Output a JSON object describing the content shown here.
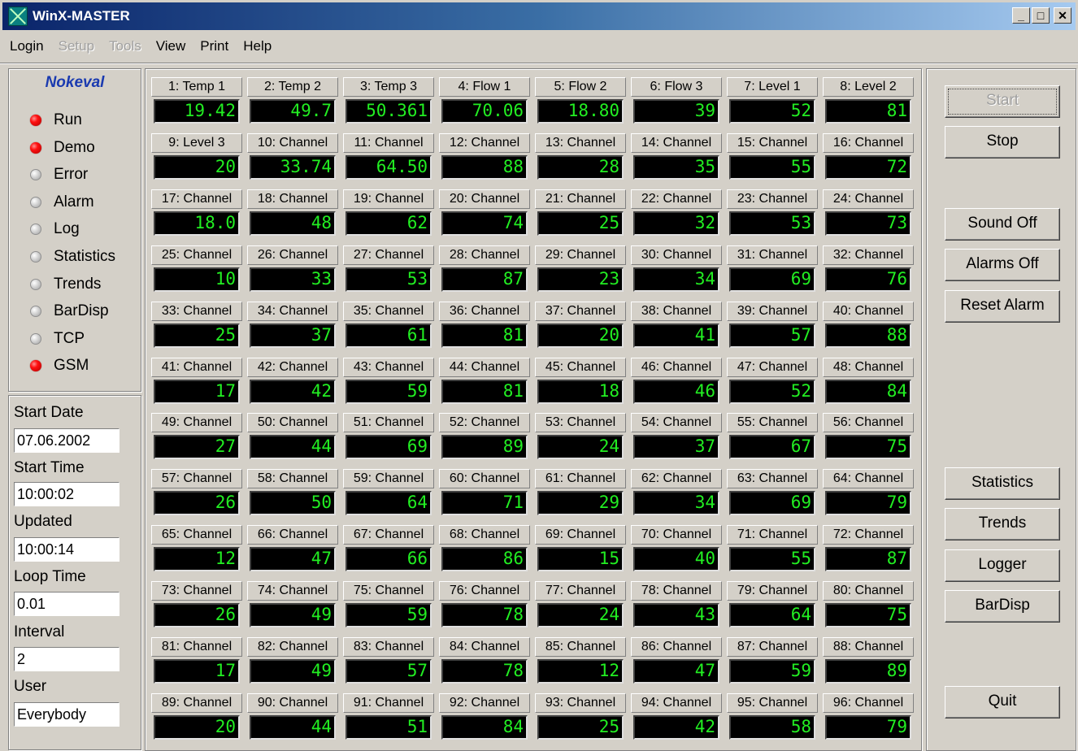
{
  "window": {
    "title": "WinX-MASTER"
  },
  "menu": [
    {
      "label": "Login",
      "enabled": true
    },
    {
      "label": "Setup",
      "enabled": false
    },
    {
      "label": "Tools",
      "enabled": false
    },
    {
      "label": "View",
      "enabled": true
    },
    {
      "label": "Print",
      "enabled": true
    },
    {
      "label": "Help",
      "enabled": true
    }
  ],
  "status": {
    "brand": "Nokeval",
    "indicators": [
      {
        "label": "Run",
        "on": true
      },
      {
        "label": "Demo",
        "on": true
      },
      {
        "label": "Error",
        "on": false
      },
      {
        "label": "Alarm",
        "on": false
      },
      {
        "label": "Log",
        "on": false
      },
      {
        "label": "Statistics",
        "on": false
      },
      {
        "label": "Trends",
        "on": false
      },
      {
        "label": "BarDisp",
        "on": false
      },
      {
        "label": "TCP",
        "on": false
      },
      {
        "label": "GSM",
        "on": true
      }
    ]
  },
  "info": {
    "start_date_label": "Start Date",
    "start_date": "07.06.2002",
    "start_time_label": "Start Time",
    "start_time": "10:00:02",
    "updated_label": "Updated",
    "updated": "10:00:14",
    "loop_time_label": "Loop Time",
    "loop_time": "0.01",
    "interval_label": "Interval",
    "interval": "2",
    "user_label": "User",
    "user": "Everybody"
  },
  "channels": [
    {
      "label": "1: Temp 1",
      "value": "19.42"
    },
    {
      "label": "2: Temp 2",
      "value": "49.7"
    },
    {
      "label": "3: Temp 3",
      "value": "50.361"
    },
    {
      "label": "4: Flow 1",
      "value": "70.06"
    },
    {
      "label": "5: Flow 2",
      "value": "18.80"
    },
    {
      "label": "6: Flow 3",
      "value": "39"
    },
    {
      "label": "7: Level 1",
      "value": "52"
    },
    {
      "label": "8: Level 2",
      "value": "81"
    },
    {
      "label": "9: Level 3",
      "value": "20"
    },
    {
      "label": "10: Channel",
      "value": "33.74"
    },
    {
      "label": "11: Channel",
      "value": "64.50"
    },
    {
      "label": "12: Channel",
      "value": "88"
    },
    {
      "label": "13: Channel",
      "value": "28"
    },
    {
      "label": "14: Channel",
      "value": "35"
    },
    {
      "label": "15: Channel",
      "value": "55"
    },
    {
      "label": "16: Channel",
      "value": "72"
    },
    {
      "label": "17: Channel",
      "value": "18.0"
    },
    {
      "label": "18: Channel",
      "value": "48"
    },
    {
      "label": "19: Channel",
      "value": "62"
    },
    {
      "label": "20: Channel",
      "value": "74"
    },
    {
      "label": "21: Channel",
      "value": "25"
    },
    {
      "label": "22: Channel",
      "value": "32"
    },
    {
      "label": "23: Channel",
      "value": "53"
    },
    {
      "label": "24: Channel",
      "value": "73"
    },
    {
      "label": "25: Channel",
      "value": "10"
    },
    {
      "label": "26: Channel",
      "value": "33"
    },
    {
      "label": "27: Channel",
      "value": "53"
    },
    {
      "label": "28: Channel",
      "value": "87"
    },
    {
      "label": "29: Channel",
      "value": "23"
    },
    {
      "label": "30: Channel",
      "value": "34"
    },
    {
      "label": "31: Channel",
      "value": "69"
    },
    {
      "label": "32: Channel",
      "value": "76"
    },
    {
      "label": "33: Channel",
      "value": "25"
    },
    {
      "label": "34: Channel",
      "value": "37"
    },
    {
      "label": "35: Channel",
      "value": "61"
    },
    {
      "label": "36: Channel",
      "value": "81"
    },
    {
      "label": "37: Channel",
      "value": "20"
    },
    {
      "label": "38: Channel",
      "value": "41"
    },
    {
      "label": "39: Channel",
      "value": "57"
    },
    {
      "label": "40: Channel",
      "value": "88"
    },
    {
      "label": "41: Channel",
      "value": "17"
    },
    {
      "label": "42: Channel",
      "value": "42"
    },
    {
      "label": "43: Channel",
      "value": "59"
    },
    {
      "label": "44: Channel",
      "value": "81"
    },
    {
      "label": "45: Channel",
      "value": "18"
    },
    {
      "label": "46: Channel",
      "value": "46"
    },
    {
      "label": "47: Channel",
      "value": "52"
    },
    {
      "label": "48: Channel",
      "value": "84"
    },
    {
      "label": "49: Channel",
      "value": "27"
    },
    {
      "label": "50: Channel",
      "value": "44"
    },
    {
      "label": "51: Channel",
      "value": "69"
    },
    {
      "label": "52: Channel",
      "value": "89"
    },
    {
      "label": "53: Channel",
      "value": "24"
    },
    {
      "label": "54: Channel",
      "value": "37"
    },
    {
      "label": "55: Channel",
      "value": "67"
    },
    {
      "label": "56: Channel",
      "value": "75"
    },
    {
      "label": "57: Channel",
      "value": "26"
    },
    {
      "label": "58: Channel",
      "value": "50"
    },
    {
      "label": "59: Channel",
      "value": "64"
    },
    {
      "label": "60: Channel",
      "value": "71"
    },
    {
      "label": "61: Channel",
      "value": "29"
    },
    {
      "label": "62: Channel",
      "value": "34"
    },
    {
      "label": "63: Channel",
      "value": "69"
    },
    {
      "label": "64: Channel",
      "value": "79"
    },
    {
      "label": "65: Channel",
      "value": "12"
    },
    {
      "label": "66: Channel",
      "value": "47"
    },
    {
      "label": "67: Channel",
      "value": "66"
    },
    {
      "label": "68: Channel",
      "value": "86"
    },
    {
      "label": "69: Channel",
      "value": "15"
    },
    {
      "label": "70: Channel",
      "value": "40"
    },
    {
      "label": "71: Channel",
      "value": "55"
    },
    {
      "label": "72: Channel",
      "value": "87"
    },
    {
      "label": "73: Channel",
      "value": "26"
    },
    {
      "label": "74: Channel",
      "value": "49"
    },
    {
      "label": "75: Channel",
      "value": "59"
    },
    {
      "label": "76: Channel",
      "value": "78"
    },
    {
      "label": "77: Channel",
      "value": "24"
    },
    {
      "label": "78: Channel",
      "value": "43"
    },
    {
      "label": "79: Channel",
      "value": "64"
    },
    {
      "label": "80: Channel",
      "value": "75"
    },
    {
      "label": "81: Channel",
      "value": "17"
    },
    {
      "label": "82: Channel",
      "value": "49"
    },
    {
      "label": "83: Channel",
      "value": "57"
    },
    {
      "label": "84: Channel",
      "value": "78"
    },
    {
      "label": "85: Channel",
      "value": "12"
    },
    {
      "label": "86: Channel",
      "value": "47"
    },
    {
      "label": "87: Channel",
      "value": "59"
    },
    {
      "label": "88: Channel",
      "value": "89"
    },
    {
      "label": "89: Channel",
      "value": "20"
    },
    {
      "label": "90: Channel",
      "value": "44"
    },
    {
      "label": "91: Channel",
      "value": "51"
    },
    {
      "label": "92: Channel",
      "value": "84"
    },
    {
      "label": "93: Channel",
      "value": "25"
    },
    {
      "label": "94: Channel",
      "value": "42"
    },
    {
      "label": "95: Channel",
      "value": "58"
    },
    {
      "label": "96: Channel",
      "value": "79"
    }
  ],
  "buttons": {
    "start": "Start",
    "stop": "Stop",
    "sound_off": "Sound Off",
    "alarms_off": "Alarms Off",
    "reset_alarm": "Reset Alarm",
    "statistics": "Statistics",
    "trends": "Trends",
    "logger": "Logger",
    "bardisp": "BarDisp",
    "quit": "Quit"
  },
  "colors": {
    "led_on": "#ff1010",
    "display_text": "#22ee22",
    "display_bg": "#000000",
    "brand": "#1a3ab0"
  }
}
